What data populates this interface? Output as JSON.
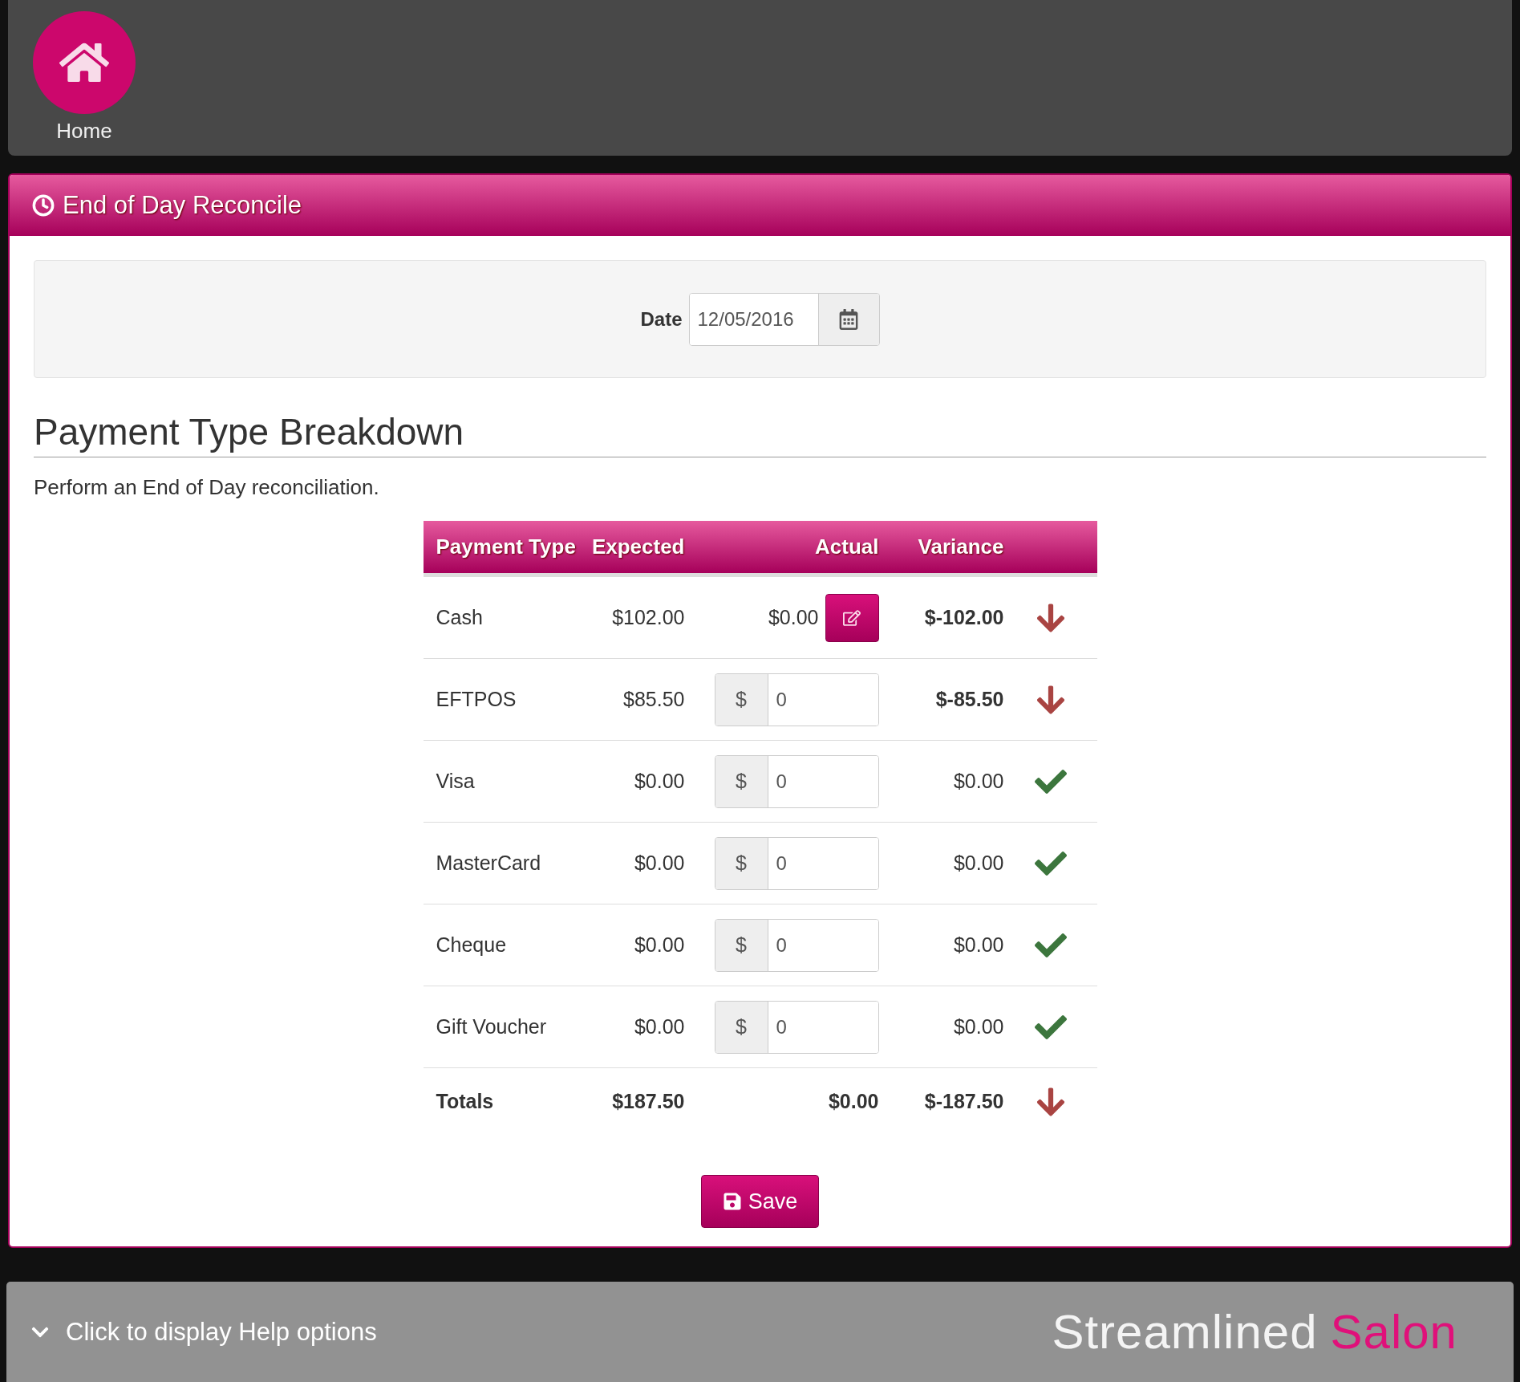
{
  "header": {
    "home_label": "Home"
  },
  "panel": {
    "title": "End of Day Reconcile"
  },
  "date": {
    "label": "Date",
    "value": "12/05/2016"
  },
  "section": {
    "heading": "Payment Type Breakdown",
    "description": "Perform an End of Day reconciliation."
  },
  "table": {
    "columns": [
      "Payment Type",
      "Expected",
      "Actual",
      "Variance"
    ],
    "rows": [
      {
        "name": "Cash",
        "expected": "$102.00",
        "actual": {
          "kind": "display",
          "value": "$0.00"
        },
        "variance": "$-102.00",
        "short": true
      },
      {
        "name": "EFTPOS",
        "expected": "$85.50",
        "actual": {
          "kind": "input",
          "prefix": "$",
          "value": "0"
        },
        "variance": "$-85.50",
        "short": true
      },
      {
        "name": "Visa",
        "expected": "$0.00",
        "actual": {
          "kind": "input",
          "prefix": "$",
          "value": "0"
        },
        "variance": "$0.00",
        "short": false
      },
      {
        "name": "MasterCard",
        "expected": "$0.00",
        "actual": {
          "kind": "input",
          "prefix": "$",
          "value": "0"
        },
        "variance": "$0.00",
        "short": false
      },
      {
        "name": "Cheque",
        "expected": "$0.00",
        "actual": {
          "kind": "input",
          "prefix": "$",
          "value": "0"
        },
        "variance": "$0.00",
        "short": false
      },
      {
        "name": "Gift Voucher",
        "expected": "$0.00",
        "actual": {
          "kind": "input",
          "prefix": "$",
          "value": "0"
        },
        "variance": "$0.00",
        "short": false
      }
    ],
    "totals": {
      "name": "Totals",
      "expected": "$187.50",
      "actual": "$0.00",
      "variance": "$-187.50",
      "short": true
    }
  },
  "save_label": "Save",
  "footer": {
    "help": "Click to display Help options",
    "brand_1": "Streamlined",
    "brand_2": "Salon"
  }
}
